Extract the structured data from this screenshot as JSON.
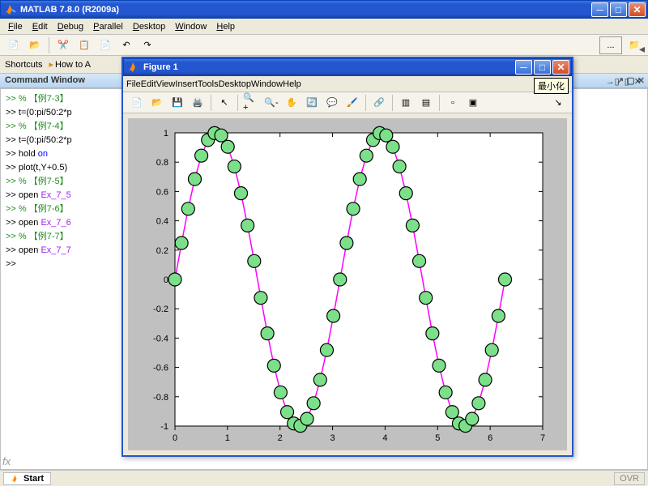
{
  "main": {
    "title": "MATLAB  7.8.0 (R2009a)",
    "menu": [
      "File",
      "Edit",
      "Debug",
      "Parallel",
      "Desktop",
      "Window",
      "Help"
    ],
    "shortcuts_label": "Shortcuts",
    "shortcut_howto": "How to A"
  },
  "cmdwin": {
    "label": "Command Window",
    "lines": [
      {
        "t": ">> % 【例7-3】",
        "cls": "kw-green"
      },
      {
        "t": ">> t=(0:pi/50:2*p"
      },
      {
        "t": ">> % 【例7-4】",
        "cls": "kw-green"
      },
      {
        "t": ">> t=(0:pi/50:2*p"
      },
      {
        "t": ">> hold on",
        "kw": "on"
      },
      {
        "t": ">> plot(t,Y+0.5)"
      },
      {
        "t": ">> % 【例7-5】",
        "cls": "kw-green"
      },
      {
        "t": ">> open Ex_7_5",
        "str": "Ex_7_5"
      },
      {
        "t": ">> % 【例7-6】",
        "cls": "kw-green"
      },
      {
        "t": ">> open Ex_7_6",
        "str": "Ex_7_6"
      },
      {
        "t": ">> % 【例7-7】",
        "cls": "kw-green"
      },
      {
        "t": ">> open Ex_7_7",
        "str": "Ex_7_7"
      },
      {
        "t": ">> "
      }
    ]
  },
  "fig": {
    "title": "Figure 1",
    "menu": [
      "File",
      "Edit",
      "View",
      "Insert",
      "Tools",
      "Desktop",
      "Window",
      "Help"
    ],
    "tooltip": "最小化"
  },
  "statusbar": {
    "start": "Start",
    "ovr": "OVR"
  },
  "chart_data": {
    "type": "line-marker",
    "x_step_label": "t = 0 : pi/50 : 2*pi (51 points)",
    "x": [
      0,
      0.1257,
      0.2513,
      0.377,
      0.5027,
      0.6283,
      0.754,
      0.8796,
      1.0053,
      1.131,
      1.2566,
      1.3823,
      1.508,
      1.6336,
      1.7593,
      1.885,
      2.0106,
      2.1363,
      2.2619,
      2.3876,
      2.5133,
      2.6389,
      2.7646,
      2.8903,
      3.0159,
      3.1416,
      3.2673,
      3.3929,
      3.5186,
      3.6442,
      3.7699,
      3.8956,
      4.0212,
      4.1469,
      4.2726,
      4.3982,
      4.5239,
      4.6496,
      4.7752,
      4.9009,
      5.0265,
      5.1522,
      5.2779,
      5.4035,
      5.5292,
      5.6549,
      5.7805,
      5.9062,
      6.0319,
      6.1575,
      6.2832
    ],
    "y": [
      0,
      0.2487,
      0.4818,
      0.6845,
      0.8443,
      0.9511,
      0.998,
      0.9823,
      0.9048,
      0.7705,
      0.5878,
      0.3681,
      0.1253,
      -0.1253,
      -0.3681,
      -0.5878,
      -0.7705,
      -0.9048,
      -0.9823,
      -0.998,
      -0.9511,
      -0.8443,
      -0.6845,
      -0.4818,
      -0.2487,
      0,
      0.2487,
      0.4818,
      0.6845,
      0.8443,
      0.9511,
      0.998,
      0.9823,
      0.9048,
      0.7705,
      0.5878,
      0.3681,
      0.1253,
      -0.1253,
      -0.3681,
      -0.5878,
      -0.7705,
      -0.9048,
      -0.9823,
      -0.998,
      -0.9511,
      -0.8443,
      -0.6845,
      -0.4818,
      -0.2487,
      0
    ],
    "line_color": "#ff00ff",
    "marker_face": "#7ce08a",
    "marker_edge": "#000000",
    "marker_radius_px": 8,
    "xlim": [
      0,
      7
    ],
    "ylim": [
      -1,
      1
    ],
    "xticks": [
      0,
      1,
      2,
      3,
      4,
      5,
      6,
      7
    ],
    "yticks": [
      -1,
      -0.8,
      -0.6,
      -0.4,
      -0.2,
      0,
      0.2,
      0.4,
      0.6,
      0.8,
      1
    ]
  }
}
